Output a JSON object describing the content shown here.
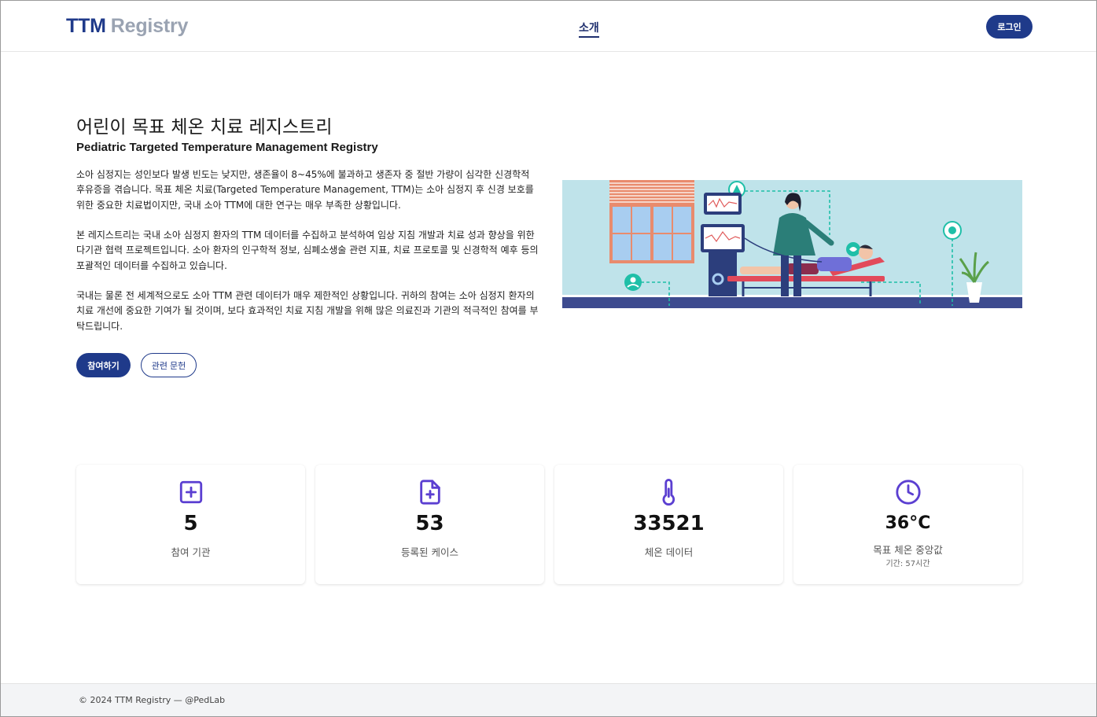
{
  "header": {
    "logo_ttm": "TTM",
    "logo_registry": "Registry",
    "nav_about": "소개",
    "login": "로그인"
  },
  "hero": {
    "title": "어린이 목표 체온 치료 레지스트리",
    "subtitle": "Pediatric Targeted Temperature Management Registry",
    "paragraph1": "소아 심정지는 성인보다 발생 빈도는 낮지만, 생존율이 8~45%에 불과하고 생존자 중 절반 가량이 심각한 신경학적 후유증을 겪습니다. 목표 체온 치료(Targeted Temperature Management, TTM)는 소아 심정지 후 신경 보호를 위한 중요한 치료법이지만, 국내 소아 TTM에 대한 연구는 매우 부족한 상황입니다.",
    "paragraph2": "본 레지스트리는 국내 소아 심정지 환자의 TTM 데이터를 수집하고 분석하여 임상 지침 개발과 치료 성과 향상을 위한 다기관 협력 프로젝트입니다. 소아 환자의 인구학적 정보, 심폐소생술 관련 지표, 치료 프로토콜 및 신경학적 예후 등의 포괄적인 데이터를 수집하고 있습니다.",
    "paragraph3": "국내는 물론 전 세계적으로도 소아 TTM 관련 데이터가 매우 제한적인 상황입니다. 귀하의 참여는 소아 심정지 환자의 치료 개선에 중요한 기여가 될 것이며, 보다 효과적인 치료 지침 개발을 위해 많은 의료진과 기관의 적극적인 참여를 부탁드립니다.",
    "btn_join": "참여하기",
    "btn_refs": "관련 문헌"
  },
  "stats": [
    {
      "icon": "plus-square-icon",
      "value": "5",
      "label": "참여 기관"
    },
    {
      "icon": "file-plus-icon",
      "value": "53",
      "label": "등록된 케이스"
    },
    {
      "icon": "thermometer-icon",
      "value": "33521",
      "label": "체온 데이터"
    },
    {
      "icon": "clock-icon",
      "value": "36°C",
      "label": "목표 체온 중앙값",
      "sublabel": "기간: 57시간"
    }
  ],
  "footer": {
    "text": "© 2024 TTM Registry —  @PedLab"
  },
  "colors": {
    "primary": "#1f3a8a",
    "icon_purple": "#5b3fd1",
    "illustration_bg": "#bfe3ea",
    "accent_teal": "#1fbfa8"
  }
}
